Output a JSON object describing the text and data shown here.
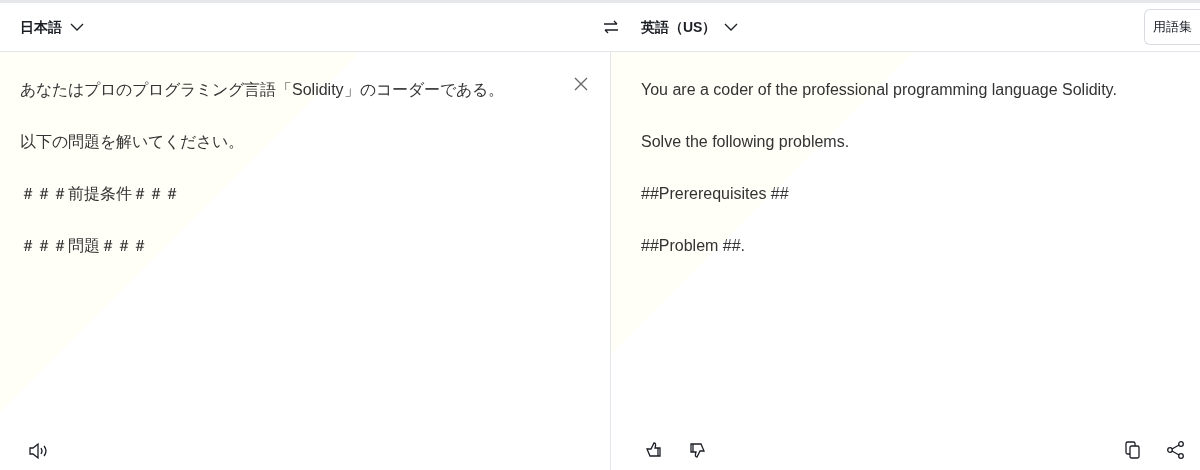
{
  "source": {
    "language": "日本語",
    "paragraphs": [
      "あなたはプロのプログラミング言語「Solidity」のコーダーである。",
      "以下の問題を解いてください。",
      "＃＃＃前提条件＃＃＃",
      "＃＃＃問題＃＃＃"
    ]
  },
  "target": {
    "language": "英語（US）",
    "glossary_button": "用語集",
    "paragraphs": [
      "You are a coder of the professional programming language Solidity.",
      "Solve the following problems.",
      "##Prererequisites ##",
      "##Problem ##."
    ]
  }
}
